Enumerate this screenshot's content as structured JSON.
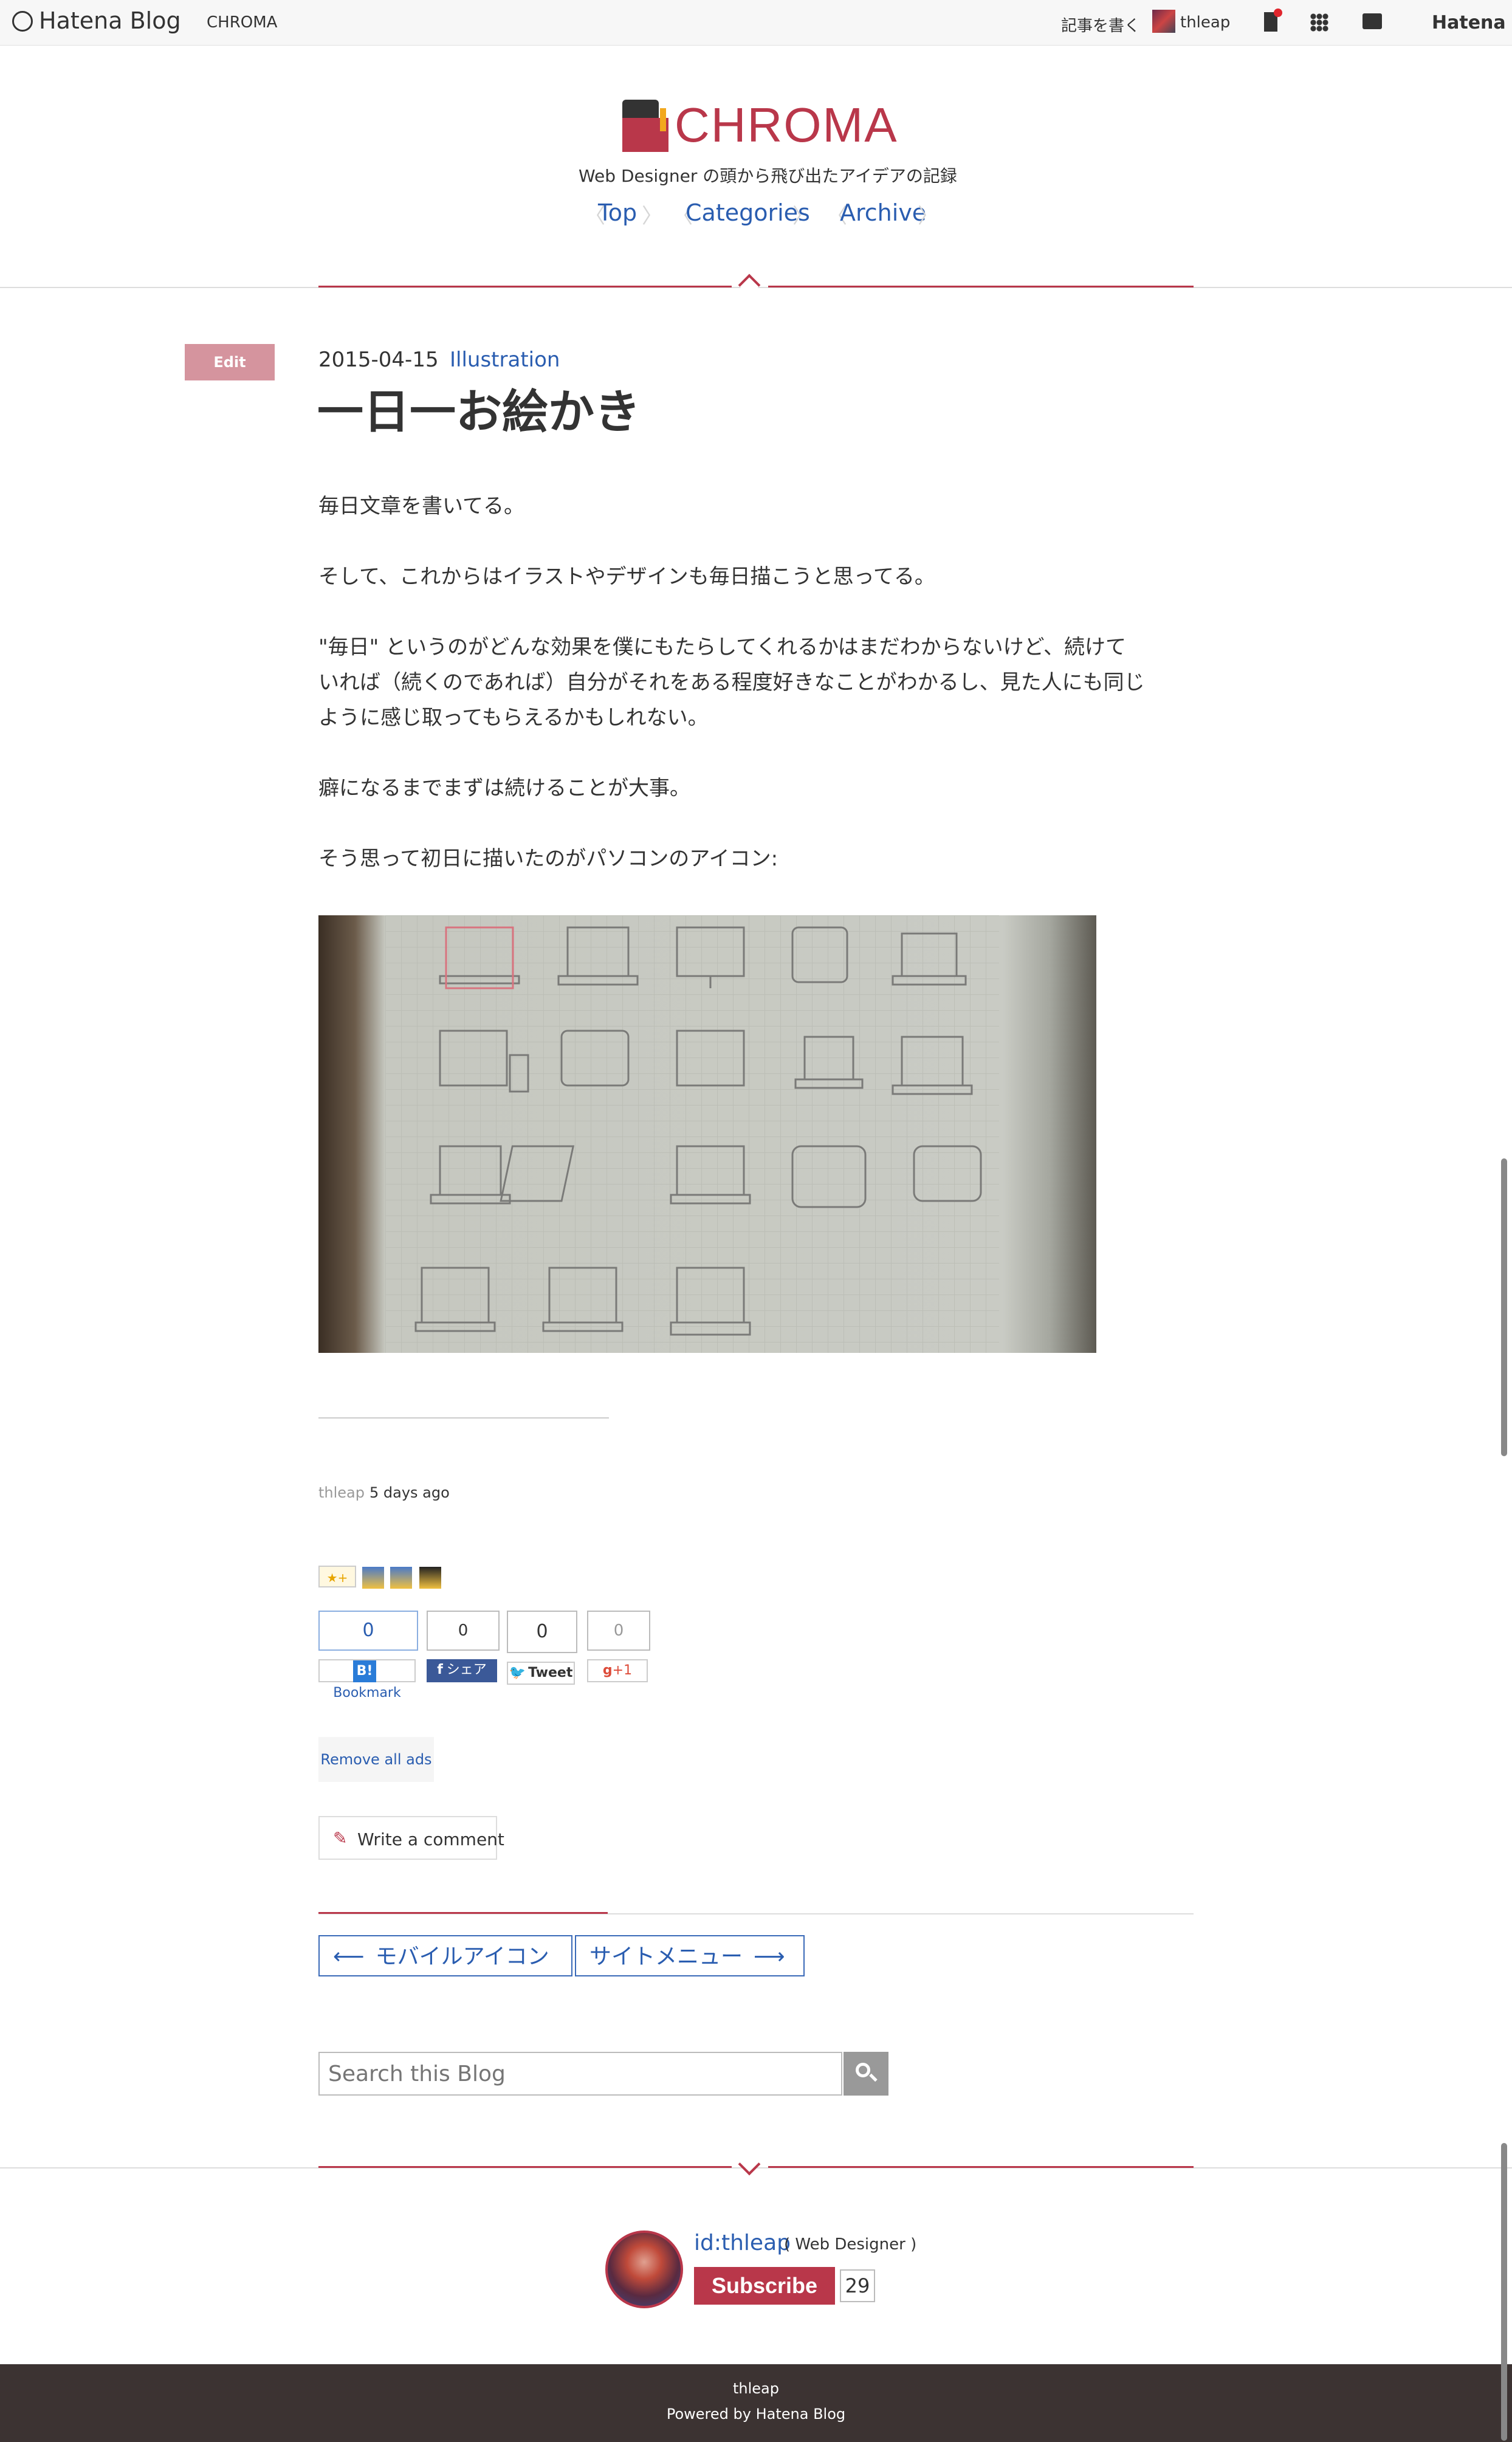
{
  "topbar": {
    "logo_text": "Hatena Blog",
    "blog_name": "CHROMA",
    "write_label": "記事を書く",
    "user_name": "thleap",
    "brand_right": "Hatena"
  },
  "header": {
    "title": "CHROMA",
    "tagline": "Web Designer の頭から飛び出たアイデアの記録",
    "nav": [
      "Top",
      "Categories",
      "Archive"
    ]
  },
  "post": {
    "edit_label": "Edit",
    "date": "2015-04-15",
    "category": "Illustration",
    "title": "一日一お絵かき",
    "paragraphs": [
      "毎日文章を書いてる。",
      "そして、これからはイラストやデザインも毎日描こうと思ってる。",
      "\"毎日\" というのがどんな効果を僕にもたらしてくれるかはまだわからないけど、続けて",
      "いれば（続くのであれば）自分がそれをある程度好きなことがわかるし、見た人にも同じ",
      "ように感じ取ってもらえるかもしれない。",
      "癖になるまでまずは続けることが大事。",
      "そう思って初日に描いたのがパソコンのアイコン:"
    ],
    "author": "thleap",
    "time_ago": "5 days ago"
  },
  "social": {
    "bookmark_count": "0",
    "bookmark_label": "Bookmark",
    "facebook_count": "0",
    "facebook_label": "シェア",
    "tweet_count": "0",
    "tweet_label": "Tweet",
    "gplus_count": "0",
    "gplus_label": "+1",
    "star_add": "★+"
  },
  "actions": {
    "remove_ads": "Remove all ads",
    "write_comment": "Write a comment"
  },
  "pager": {
    "prev": "モバイルアイコン",
    "next": "サイトメニュー"
  },
  "search": {
    "placeholder": "Search this Blog"
  },
  "profile": {
    "id": "id:thleap",
    "role": "( Web Designer )",
    "subscribe_label": "Subscribe",
    "subscriber_count": "29"
  },
  "footer": {
    "name": "thleap",
    "powered": "Powered by Hatena Blog"
  },
  "colors": {
    "accent": "#b9374a",
    "link": "#2a5db0",
    "footer_bg": "#3c3332"
  }
}
